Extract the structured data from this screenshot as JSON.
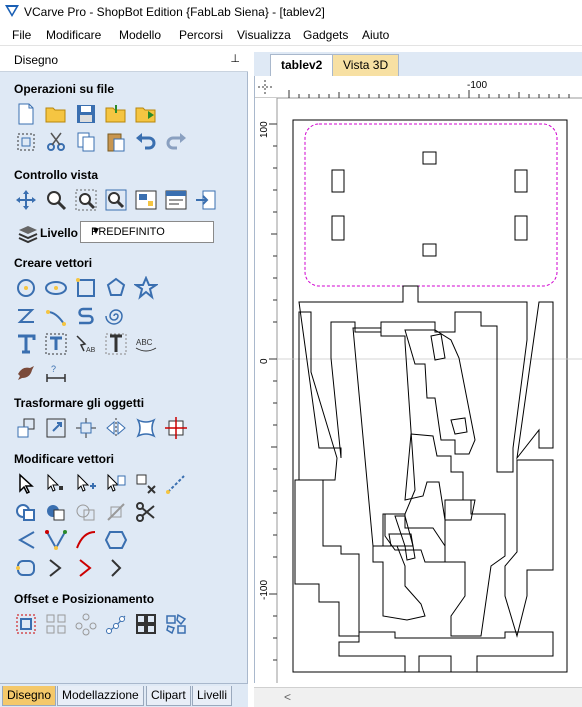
{
  "window": {
    "title": "VCarve Pro - ShopBot Edition {FabLab Siena} - [tablev2]"
  },
  "menu": [
    "File",
    "Modificare",
    "Modello",
    "Percorsi",
    "Visualizza",
    "Gadgets",
    "Aiuto"
  ],
  "panel": {
    "title": "Disegno",
    "pin": "⊥",
    "sections": {
      "file_ops": "Operazioni su file",
      "view_control": "Controllo vista",
      "create_vectors": "Creare vettori",
      "transform": "Trasformare gli oggetti",
      "edit_vectors": "Modificare vettori",
      "offset": "Offset e Posizionamento"
    },
    "layer": {
      "label": "Livello",
      "value": "PREDEFINITO"
    }
  },
  "bottom_tabs": [
    "Disegno",
    "Modellazzione",
    "Clipart",
    "Livelli"
  ],
  "doc_tabs": [
    "tablev2",
    "Vista 3D"
  ],
  "rulers": {
    "top_label": "-100",
    "left_labels": [
      "100",
      "0",
      "-100"
    ]
  },
  "colors": {
    "panel_bg": "#dfe9f5",
    "active_tab": "#f4c86a",
    "inactive_doc_tab": "#f7e0a3",
    "dashed_boundary": "#d000d0"
  }
}
